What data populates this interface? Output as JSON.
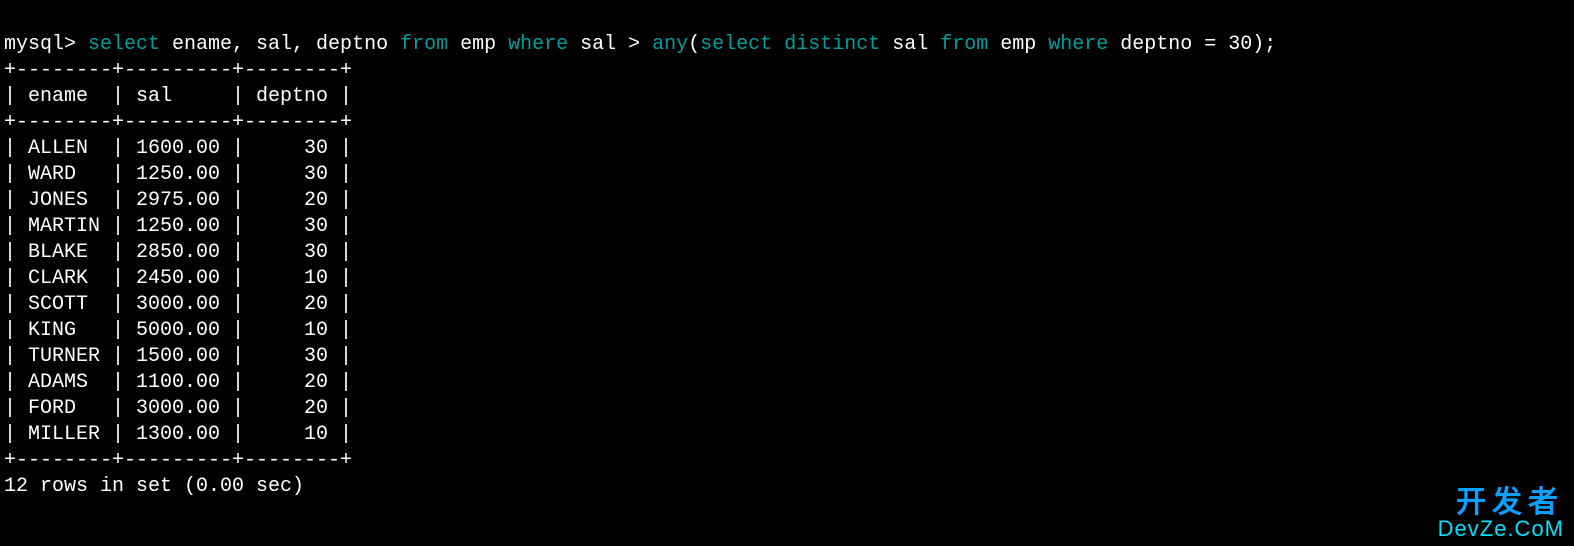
{
  "prompt": "mysql> ",
  "sql": {
    "kw_select": "select",
    "cols": " ename, sal, deptno ",
    "kw_from": "from",
    "tbl": " emp ",
    "kw_where": "where",
    "cond1": " sal > ",
    "kw_any": "any",
    "paren_open": "(",
    "kw_select2": "select",
    "kw_distinct": " distinct",
    "col2": " sal ",
    "kw_from2": "from",
    "tbl2": " emp ",
    "kw_where2": "where",
    "cond2": " deptno = 30);"
  },
  "table": {
    "border_top": "+--------+---------+--------+",
    "header_row": "| ename  | sal     | deptno |",
    "border_mid": "+--------+---------+--------+",
    "border_bottom": "+--------+---------+--------+",
    "columns": [
      "ename",
      "sal",
      "deptno"
    ],
    "rows": [
      {
        "ename": "ALLEN",
        "sal": "1600.00",
        "deptno": "30"
      },
      {
        "ename": "WARD",
        "sal": "1250.00",
        "deptno": "30"
      },
      {
        "ename": "JONES",
        "sal": "2975.00",
        "deptno": "20"
      },
      {
        "ename": "MARTIN",
        "sal": "1250.00",
        "deptno": "30"
      },
      {
        "ename": "BLAKE",
        "sal": "2850.00",
        "deptno": "30"
      },
      {
        "ename": "CLARK",
        "sal": "2450.00",
        "deptno": "10"
      },
      {
        "ename": "SCOTT",
        "sal": "3000.00",
        "deptno": "20"
      },
      {
        "ename": "KING",
        "sal": "5000.00",
        "deptno": "10"
      },
      {
        "ename": "TURNER",
        "sal": "1500.00",
        "deptno": "30"
      },
      {
        "ename": "ADAMS",
        "sal": "1100.00",
        "deptno": "20"
      },
      {
        "ename": "FORD",
        "sal": "3000.00",
        "deptno": "20"
      },
      {
        "ename": "MILLER",
        "sal": "1300.00",
        "deptno": "10"
      }
    ]
  },
  "status": "12 rows in set (0.00 sec)",
  "watermark": {
    "line1": "开发者",
    "line2": "DevZe.CoM"
  }
}
